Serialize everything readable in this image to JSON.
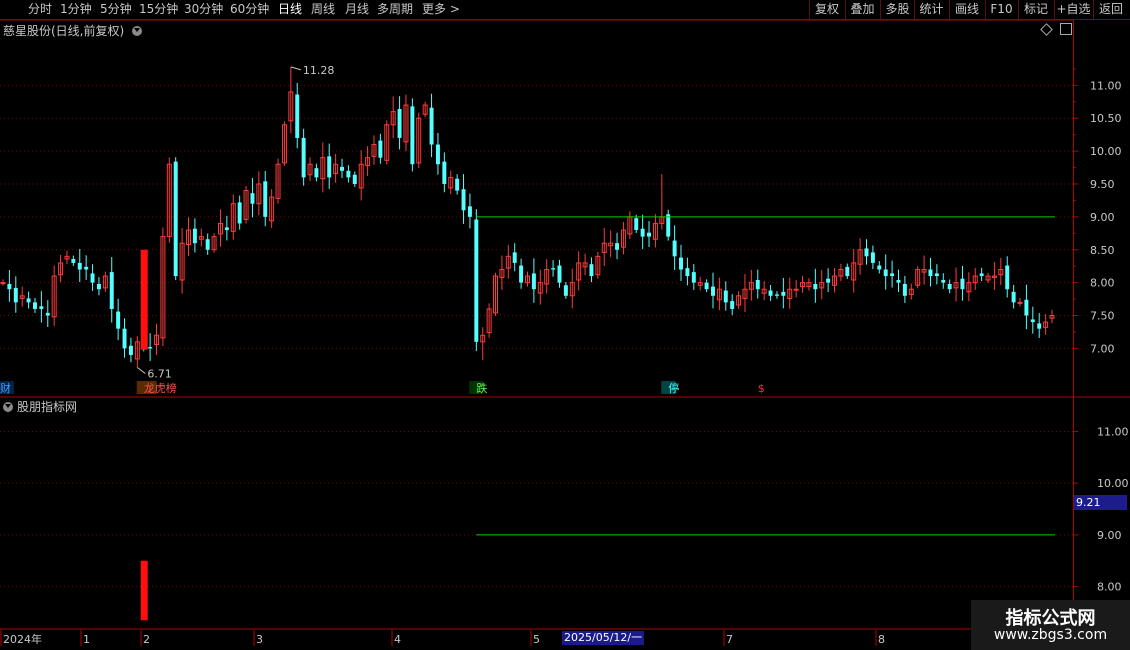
{
  "toolbar": {
    "periods": [
      "分时",
      "1分钟",
      "5分钟",
      "15分钟",
      "30分钟",
      "60分钟",
      "日线",
      "周线",
      "月线",
      "多周期",
      "更多 >"
    ],
    "active_period": "日线",
    "right_buttons": [
      "复权",
      "叠加",
      "多股",
      "统计",
      "画线",
      "F10",
      "标记",
      "+自选",
      "返回"
    ]
  },
  "main_panel": {
    "title": "慈星股份(日线,前复权)"
  },
  "sub_panel": {
    "title": "股朋指标网"
  },
  "colors": {
    "up": "#ff3b3b",
    "down": "#54ffff",
    "line": "#00d000",
    "axis": "#b40000",
    "signal": "#ff1010"
  },
  "chart_data": [
    {
      "type": "candlestick",
      "ylim": [
        6.55,
        11.75
      ],
      "yticks": [
        7.0,
        7.5,
        8.0,
        8.5,
        9.0,
        9.5,
        10.0,
        10.5,
        11.0
      ],
      "tick_labels": [
        "7.00",
        "7.50",
        "8.00",
        "8.50",
        "9.00",
        "9.50",
        "10.00",
        "10.50",
        "11.00"
      ],
      "max_label": "11.28",
      "min_label": "6.71",
      "closes": [
        8.0,
        7.9,
        7.7,
        7.8,
        7.7,
        7.6,
        7.6,
        7.5,
        8.1,
        8.3,
        8.4,
        8.3,
        8.2,
        8.2,
        8.0,
        7.9,
        8.1,
        7.6,
        7.3,
        7.0,
        6.9,
        7.1,
        7.0,
        7.0,
        7.2,
        8.7,
        9.8,
        8.1,
        8.6,
        8.8,
        8.6,
        8.7,
        8.5,
        8.7,
        8.9,
        8.8,
        9.2,
        8.9,
        9.4,
        9.2,
        9.5,
        9.0,
        9.3,
        9.8,
        10.4,
        10.9,
        10.2,
        9.6,
        9.8,
        9.6,
        9.9,
        9.6,
        9.8,
        9.7,
        9.6,
        9.5,
        9.8,
        9.9,
        10.1,
        9.9,
        10.4,
        10.6,
        10.2,
        10.7,
        9.8,
        10.5,
        10.7,
        10.1,
        9.8,
        9.5,
        9.6,
        9.4,
        9.1,
        9.0,
        7.1,
        7.2,
        7.6,
        8.1,
        8.2,
        8.4,
        8.3,
        8.0,
        8.1,
        7.9,
        8.0,
        8.2,
        8.2,
        8.0,
        7.8,
        8.0,
        8.3,
        8.3,
        8.1,
        8.4,
        8.6,
        8.6,
        8.5,
        8.8,
        9.0,
        8.8,
        8.7,
        8.7,
        8.9,
        9.0,
        8.7,
        8.4,
        8.2,
        8.1,
        8.0,
        8.0,
        7.9,
        7.8,
        7.9,
        7.7,
        7.6,
        7.8,
        7.9,
        8.0,
        7.9,
        7.9,
        7.8,
        7.8,
        7.8,
        7.9,
        7.9,
        8.0,
        8.0,
        7.9,
        8.0,
        8.0,
        8.1,
        8.2,
        8.1,
        8.3,
        8.5,
        8.4,
        8.3,
        8.2,
        8.1,
        8.1,
        8.0,
        7.8,
        7.9,
        8.2,
        8.2,
        8.1,
        8.1,
        8.0,
        7.9,
        8.0,
        7.9,
        8.0,
        8.1,
        8.1,
        8.1,
        8.1,
        8.2,
        7.9,
        7.7,
        7.7,
        7.5,
        7.4,
        7.3,
        7.4,
        7.5
      ],
      "markers": [
        {
          "label": "龙虎榜",
          "color": "#ff5050",
          "bg": "#5a2a00"
        },
        {
          "label": "跌",
          "color": "#50ff50",
          "bg": "#003300"
        },
        {
          "label": "停",
          "color": "#40ffff",
          "bg": "#004444"
        },
        {
          "label": "$",
          "color": "#ff3030",
          "bg": ""
        },
        {
          "label": "财",
          "color": "#40a0ff",
          "bg": "#002244"
        }
      ],
      "resistance_level": 9.0
    },
    {
      "type": "indicator",
      "ylim": [
        7.2,
        11.55
      ],
      "yticks": [
        8.0,
        9.0,
        10.0,
        11.0
      ],
      "tick_labels": [
        "8.00",
        "9.00",
        "10.00",
        "11.00"
      ],
      "current_value": "9.21",
      "signal_bar": [
        7.35,
        8.5
      ],
      "level": 9.0
    }
  ],
  "x_axis": {
    "labels": [
      "2024年",
      "1",
      "2",
      "3",
      "4",
      "5",
      "2025/05/12/一",
      "7",
      "8"
    ]
  },
  "watermark": {
    "main": "指标公式网",
    "sub": "www.zbgs3.com"
  }
}
